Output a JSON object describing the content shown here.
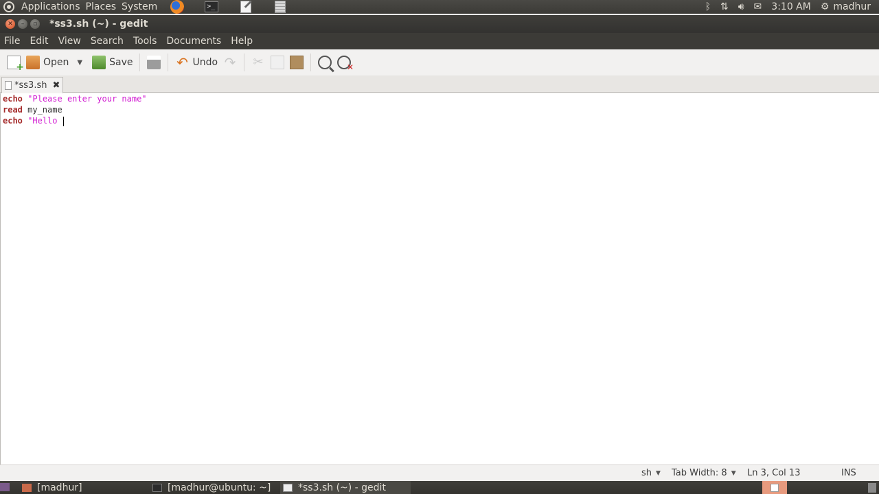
{
  "top_panel": {
    "menus": [
      "Applications",
      "Places",
      "System"
    ],
    "launchers": [
      "firefox-icon",
      "terminal-icon",
      "text-editor-icon",
      "calculator-icon"
    ],
    "time": "3:10 AM",
    "user": "madhur"
  },
  "window": {
    "title": "*ss3.sh (~) - gedit"
  },
  "menubar": [
    "File",
    "Edit",
    "View",
    "Search",
    "Tools",
    "Documents",
    "Help"
  ],
  "toolbar": {
    "open_label": "Open",
    "save_label": "Save",
    "undo_label": "Undo"
  },
  "tab": {
    "label": "*ss3.sh"
  },
  "editor": {
    "lines": [
      {
        "kw": "echo",
        "rest": " ",
        "str": "\"Please enter your name\""
      },
      {
        "kw": "read",
        "rest": " my_name",
        "str": ""
      },
      {
        "kw": "echo",
        "rest": " ",
        "str": "\"Hello "
      }
    ]
  },
  "status": {
    "language": "sh",
    "tab_width": "Tab Width: 8",
    "position": "Ln 3, Col 13",
    "mode": "INS"
  },
  "taskbar": [
    {
      "label": "[madhur]",
      "active": false
    },
    {
      "label": "[madhur@ubuntu: ~]",
      "active": false
    },
    {
      "label": "*ss3.sh (~) - gedit",
      "active": true
    }
  ],
  "colors": {
    "keyword": "#a52a2a",
    "string": "#d21ed2",
    "close_button": "#d14b1e"
  }
}
